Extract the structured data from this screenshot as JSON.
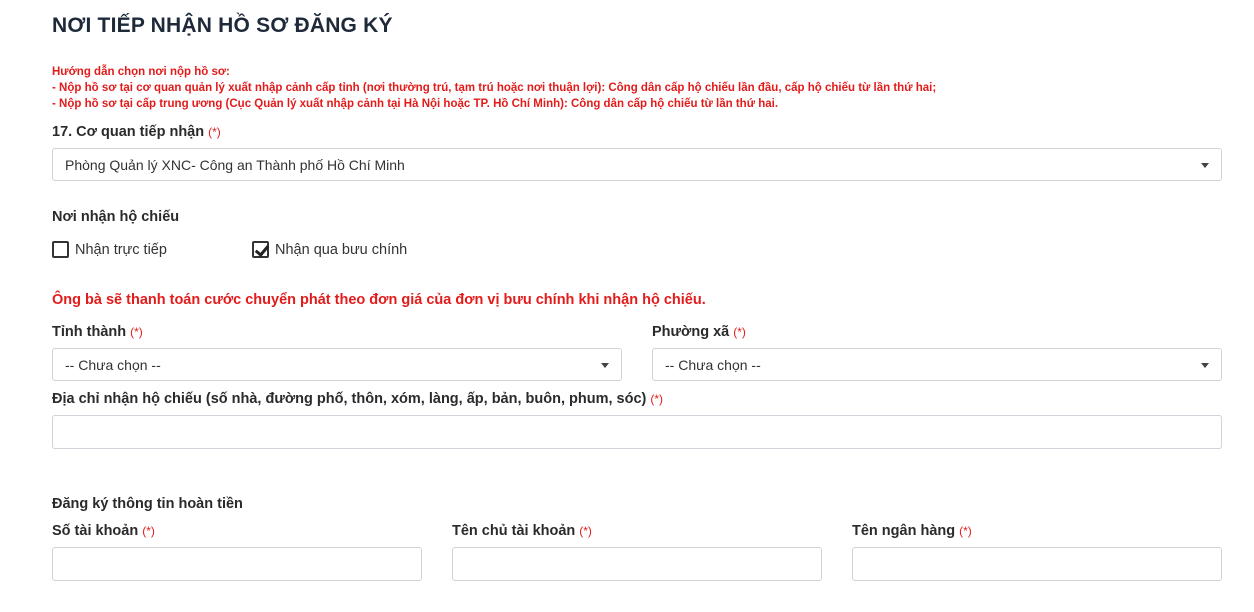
{
  "section_title": "NƠI TIẾP NHẬN HỒ SƠ ĐĂNG KÝ",
  "guide": {
    "line1": "Hướng dẫn chọn nơi nộp hồ sơ:",
    "line2": "- Nộp hồ sơ tại cơ quan quản lý xuất nhập cảnh cấp tỉnh (nơi thường trú, tạm trú hoặc nơi thuận lợi): Công dân cấp hộ chiếu lần đầu, cấp hộ chiếu từ lần thứ hai;",
    "line3": "- Nộp hồ sơ tại cấp trung ương (Cục Quản lý xuất nhập cảnh tại Hà Nội hoặc TP. Hồ Chí Minh): Công dân cấp hộ chiếu từ lần thứ hai."
  },
  "required_mark": "(*)",
  "agency": {
    "label": "17. Cơ quan tiếp nhận",
    "selected": "Phòng Quản lý XNC- Công an Thành phố Hồ Chí Minh"
  },
  "passport_receipt": {
    "label": "Nơi nhận hộ chiếu",
    "options": [
      {
        "label": "Nhận trực tiếp",
        "checked": false
      },
      {
        "label": "Nhận qua bưu chính",
        "checked": true
      }
    ]
  },
  "postal_notice": "Ông bà sẽ thanh toán cước chuyển phát theo đơn giá của đơn vị bưu chính khi nhận hộ chiếu.",
  "province": {
    "label": "Tỉnh thành",
    "selected": "-- Chưa chọn --"
  },
  "ward": {
    "label": "Phường xã",
    "selected": "-- Chưa chọn --"
  },
  "address": {
    "label": "Địa chỉ nhận hộ chiếu (số nhà, đường phố, thôn, xóm, làng, ấp, bản, buôn, phum, sóc)",
    "value": ""
  },
  "refund": {
    "heading": "Đăng ký thông tin hoàn tiền",
    "account_number_label": "Số tài khoản",
    "account_holder_label": "Tên chủ tài khoản",
    "bank_name_label": "Tên ngân hàng",
    "account_number_value": "",
    "account_holder_value": "",
    "bank_name_value": ""
  },
  "colors": {
    "required": "#e31b1b",
    "title": "#1e2a3a",
    "border": "#cfd4da"
  }
}
